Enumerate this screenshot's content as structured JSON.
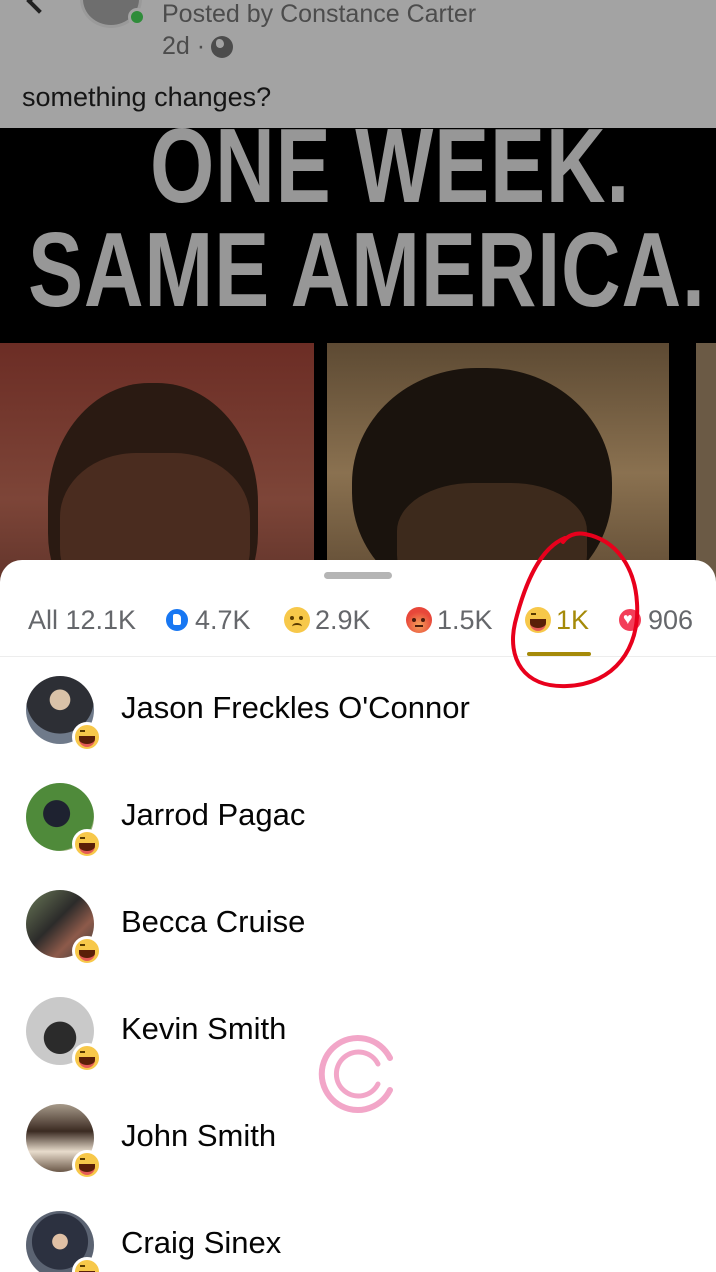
{
  "post": {
    "posted_by": "Posted by Constance Carter",
    "age": "2d ·",
    "text": "something changes?"
  },
  "image": {
    "headline_line1": "ONE WEEK.",
    "headline_line2": "SAME AMERICA."
  },
  "reactions": {
    "tabs": [
      {
        "label": "All 12.1K",
        "icon": null,
        "selected": false
      },
      {
        "label": "4.7K",
        "icon": "like-icon",
        "selected": false
      },
      {
        "label": "2.9K",
        "icon": "sad-icon",
        "selected": false
      },
      {
        "label": "1.5K",
        "icon": "angry-icon",
        "selected": false
      },
      {
        "label": "1K",
        "icon": "haha-icon",
        "selected": true
      },
      {
        "label": "906",
        "icon": "love-icon",
        "selected": false
      }
    ],
    "selected_color": "#a58a09",
    "people": [
      {
        "name": "Jason Freckles O'Connor",
        "reaction": "haha-icon"
      },
      {
        "name": "Jarrod Pagac",
        "reaction": "haha-icon"
      },
      {
        "name": "Becca Cruise",
        "reaction": "haha-icon"
      },
      {
        "name": "Kevin Smith",
        "reaction": "haha-icon"
      },
      {
        "name": "John Smith",
        "reaction": "haha-icon"
      },
      {
        "name": "Craig Sinex",
        "reaction": "haha-icon"
      }
    ]
  },
  "annotation_color": "#e8001c"
}
